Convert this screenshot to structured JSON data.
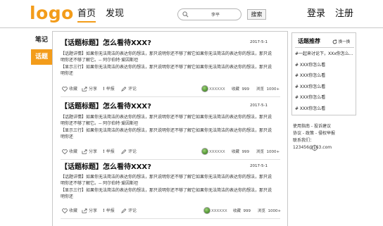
{
  "header": {
    "logo": "logo",
    "nav": {
      "home": "首页",
      "discover": "发现"
    },
    "search": {
      "value": "李平"
    },
    "search_button": "搜索",
    "login": "登录",
    "register": "注册",
    "accent_color": "#f39c1a"
  },
  "side_tabs": {
    "notes": "笔记",
    "topic": "话题",
    "active": "话题"
  },
  "feed": {
    "cards": [
      {
        "title": "【话题标题】怎么看待XXX?",
        "date": "2017-5-1",
        "line1": "【话题详情】如果你无法简洁的表达你的想法，那只说明你还不够了解它如果你无法简洁的表达你的想法，那只说",
        "line2": "明你还不够了解它。-- 阿尔伯特·爱因斯坦",
        "line3": "【显示三行】如果你无法简洁的表达你的想法，那只说明你还不够了解它如果你无法简洁的表达你的想法，那只说",
        "line4": "明你还",
        "actions": {
          "collect": "收藏",
          "share": "分享",
          "report": "举报",
          "comment": "评论"
        },
        "author": "XXXXXX",
        "collect_label": "收藏",
        "collect_count": "999",
        "views_label": "浏览",
        "views_count": "1000+"
      },
      {
        "title": "【话题标题】怎么看待XXX?",
        "date": "2017-5-1",
        "line1": "【话题详情】如果你无法简洁的表达你的想法，那只说明你还不够了解它如果你无法简洁的表达你的想法，那只说",
        "line2": "明你还不够了解它。-- 阿尔伯特·爱因斯坦",
        "line3": "【显示三行】如果你无法简洁的表达你的想法，那只说明你还不够了解它如果你无法简洁的表达你的想法，那只说",
        "line4": "明你还",
        "actions": {
          "collect": "收藏",
          "share": "分享",
          "report": "举报",
          "comment": "评论"
        },
        "author": "XXXXXX",
        "collect_label": "收藏",
        "collect_count": "999",
        "views_label": "浏览",
        "views_count": "1000+"
      },
      {
        "title": "【话题标题】怎么看待XXX?",
        "date": "2017-5-1",
        "line1": "【话题详情】如果你无法简洁的表达你的想法，那只说明你还不够了解它如果你无法简洁的表达你的想法，那只说",
        "line2": "明你还不够了解它。-- 阿尔伯特·爱因斯坦",
        "line3": "【显示三行】如果你无法简洁的表达你的想法，那只说明你还不够了解它如果你无法简洁的表达你的想法，那只说",
        "line4": "明你还",
        "actions": {
          "collect": "收藏",
          "share": "分享",
          "report": "举报",
          "comment": "评论"
        },
        "author": "XXXXXX",
        "collect_label": "收藏",
        "collect_count": "999",
        "views_label": "浏览",
        "views_count": "1000+"
      }
    ]
  },
  "recommend": {
    "title": "话题推荐",
    "refresh": "换一换",
    "items": [
      "#一起来讨论下，XXx你怎么...",
      "# XXX你怎么看",
      "# XXX你怎么看",
      "# XXX你怎么看",
      "# XXX你怎么看",
      "# XXX你怎么看"
    ]
  },
  "footer": {
    "line1": "使用指南 - 投诉建议",
    "line2": "协议 - 政策 - 侵权举报",
    "line3": "联系我们：",
    "email": "123456@163.com"
  }
}
